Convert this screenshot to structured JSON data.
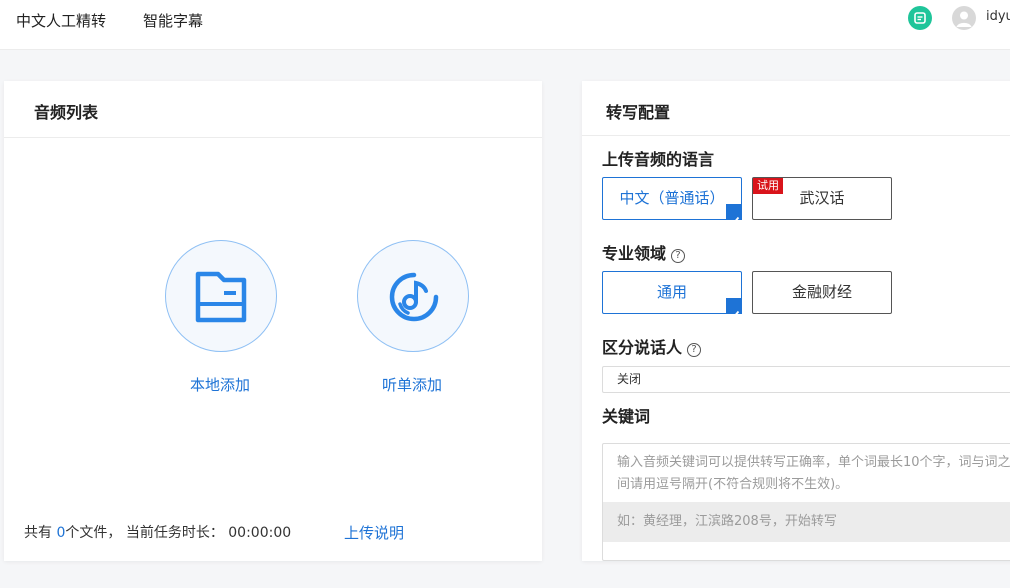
{
  "header": {
    "nav": [
      "中文人工精转",
      "智能字幕"
    ],
    "username": "idyu",
    "colors": {
      "chat": "#1fc59a"
    }
  },
  "audio_list": {
    "title": "音频列表",
    "local_add": "本地添加",
    "playlist_add": "听单添加",
    "footer": {
      "prefix": "共有 ",
      "count": "0",
      "suffix": "个文件， 当前任务时长： 00:00:00",
      "upload_help": "上传说明"
    }
  },
  "config": {
    "title": "转写配置",
    "language": {
      "label": "上传音频的语言",
      "options": [
        "中文（普通话）",
        "武汉话"
      ],
      "trial_badge": "试用"
    },
    "domain": {
      "label": "专业领域",
      "options": [
        "通用",
        "金融财经"
      ]
    },
    "speaker": {
      "label": "区分说话人",
      "value": "关闭"
    },
    "keywords": {
      "label": "关键词",
      "placeholder": "输入音频关键词可以提供转写正确率，单个词最长10个字，词与词之间请用逗号隔开(不符合规则将不生效)。",
      "example": "如：黄经理，江滨路208号，开始转写"
    }
  },
  "accent_color": "#1e73d6"
}
